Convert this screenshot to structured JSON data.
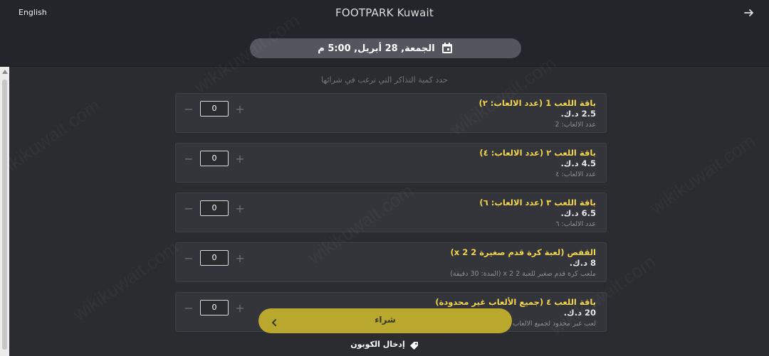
{
  "header": {
    "language_link": "English",
    "title": "FOOTPARK Kuwait",
    "forward_icon": "arrow-right-icon"
  },
  "booking": {
    "date_time": "الجمعة, 28 أبريل, 5:00 م",
    "calendar_icon": "calendar-icon"
  },
  "instruction": "حدد كمية التذاكر التي ترغب في شرائها",
  "packages": [
    {
      "name": "باقة اللعب 1 (عدد الالعاب: ٢)",
      "price": "2.5 د.ك.",
      "desc": "عدد الالعاب: 2",
      "qty": "0"
    },
    {
      "name": "باقة اللعب ٢ (عدد الالعاب: ٤)",
      "price": "4.5 د.ك.",
      "desc": "عدد الالعاب: ٤",
      "qty": "0"
    },
    {
      "name": "باقة اللعب ٣ (عدد الالعاب: ٦)",
      "price": "6.5 د.ك.",
      "desc": "عدد الالعاب: ٦",
      "qty": "0"
    },
    {
      "name": "القفص (لعبة كرة قدم صغيرة 2 x 2)",
      "price": "8 د.ك.",
      "desc": "ملعب كرة قدم صغير للعبة 2 x 2 (المدة: 30 دقيقة)",
      "qty": "0"
    },
    {
      "name": "باقة اللعب ٤ (جميع الألعاب غير محدودة)",
      "price": "20 د.ك.",
      "desc": "لعب غير محدود لجميع الالعاب",
      "qty": "0"
    }
  ],
  "stepper": {
    "minus": "−",
    "plus": "+"
  },
  "actions": {
    "buy_label": "شراء",
    "coupon_label": "إدخال الكوبون",
    "coupon_icon": "tag-icon"
  },
  "colors": {
    "accent": "#f3d64a",
    "buy_button": "#c5b22c",
    "background": "#2b2c30"
  }
}
